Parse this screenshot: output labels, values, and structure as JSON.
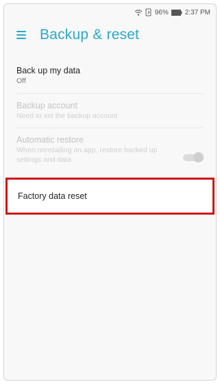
{
  "status_bar": {
    "battery_percent": "96%",
    "time": "2:37 PM",
    "icons": [
      "wifi-icon",
      "data-sync-icon",
      "battery-icon"
    ]
  },
  "header": {
    "title": "Backup & reset",
    "menu_icon": "hamburger-menu-icon"
  },
  "settings": [
    {
      "label": "Back up my data",
      "sub": "Off"
    },
    {
      "label": "Backup account",
      "sub": "Need to set the backup account"
    },
    {
      "label": "Automatic restore",
      "sub": "When reinstalling an app, restore backed up settings and data"
    }
  ],
  "highlighted_item": {
    "label": "Factory data reset"
  },
  "colors": {
    "accent": "#2aa7c9",
    "highlight_border": "#d01617",
    "disabled_text": "#c2c2c2"
  }
}
